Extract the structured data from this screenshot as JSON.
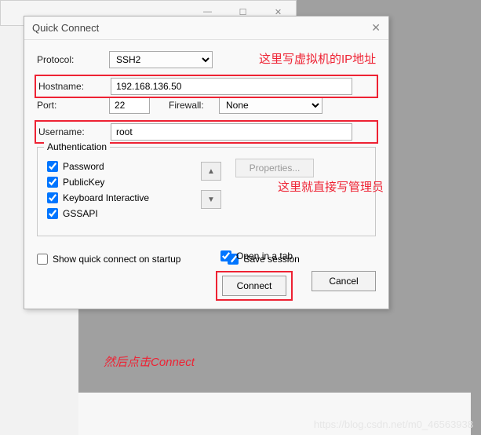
{
  "dialog": {
    "title": "Quick Connect",
    "close": "✕",
    "protocol": {
      "label": "Protocol:",
      "value": "SSH2"
    },
    "hostname": {
      "label": "Hostname:",
      "value": "192.168.136.50"
    },
    "port": {
      "label": "Port:",
      "value": "22"
    },
    "firewall": {
      "label": "Firewall:",
      "value": "None"
    },
    "username": {
      "label": "Username:",
      "value": "root"
    },
    "authentication": {
      "legend": "Authentication",
      "items": [
        {
          "label": "Password",
          "checked": true
        },
        {
          "label": "PublicKey",
          "checked": true
        },
        {
          "label": "Keyboard Interactive",
          "checked": true
        },
        {
          "label": "GSSAPI",
          "checked": true
        }
      ],
      "properties": "Properties..."
    },
    "show_on_startup": {
      "label": "Show quick connect on startup",
      "checked": false
    },
    "save_session": {
      "label": "Save session",
      "checked": true
    },
    "open_in_tab": {
      "label": "Open in a tab",
      "checked": true
    },
    "connect": "Connect",
    "cancel": "Cancel"
  },
  "annotations": {
    "a1": "这里写虚拟机的IP地址",
    "a2": "这里就直接写管理员",
    "a3": "然后点击Connect"
  },
  "watermark": "https://blog.csdn.net/m0_46563938",
  "bgwin": {
    "minimize": "—",
    "maximize": "☐",
    "close": "✕"
  }
}
